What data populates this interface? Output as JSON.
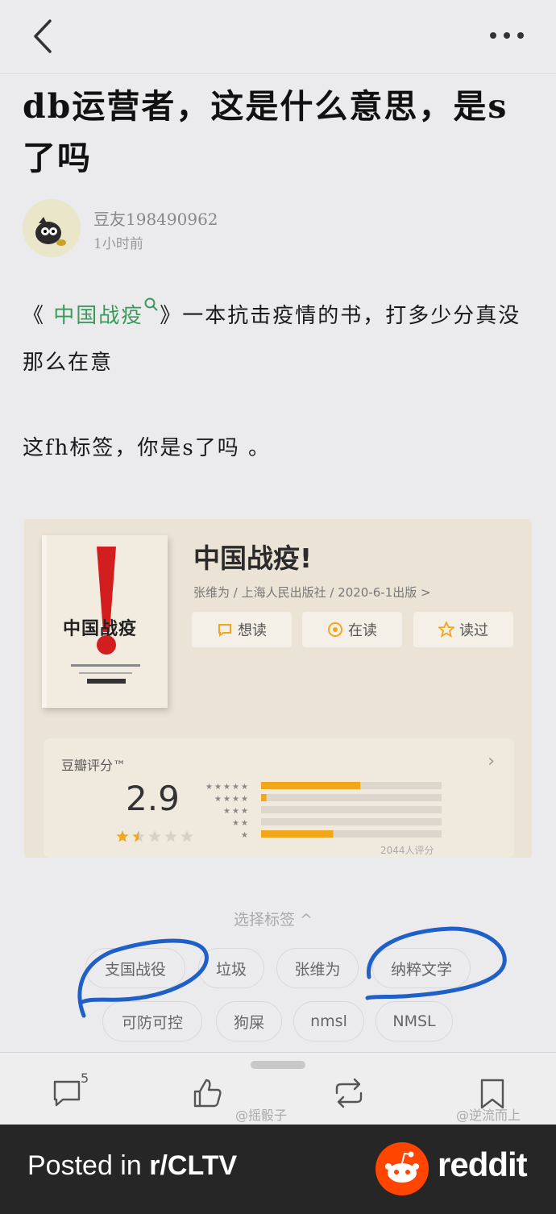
{
  "post": {
    "title": "db运营者，这是什么意思，是s了吗",
    "author": "豆友198490962",
    "time": "1小时前",
    "para1_open": "《",
    "para1_link": "中国战疫",
    "para1_rest": "》一本抗击疫情的书，打多少分真没那么在意",
    "para2": "这fh标签，你是s了吗 。"
  },
  "embedded": {
    "cover_title": "中国战疫",
    "book_title": "中国战疫!",
    "book_meta": "张维为 / 上海人民出版社 / 2020-6-1出版 >",
    "actions": [
      "想读",
      "在读",
      "读过"
    ],
    "rating_label": "豆瓣评分™",
    "rating_value": "2.9",
    "rating_count": "2044人评分",
    "star_distribution_pct": [
      55,
      3,
      0,
      0,
      40
    ],
    "tag_header": "选择标签 ^",
    "tags": [
      "支国战役",
      "垃圾",
      "张维为",
      "纳粹文学",
      "可防可控",
      "狗屎",
      "nmsl",
      "NMSL"
    ]
  },
  "toolbar": {
    "comment_count": "5",
    "icons": [
      "comment-icon",
      "like-icon",
      "repost-icon",
      "bookmark-icon"
    ],
    "watermark_left": "@摇骰子",
    "watermark_right": "@逆流而上"
  },
  "footer": {
    "posted_prefix": "Posted in ",
    "subreddit": "r/CLTV",
    "brand": "reddit"
  },
  "colors": {
    "link_green": "#3a9a5c",
    "bar_orange": "#f2a71b",
    "circle_blue": "#1f5fc8",
    "reddit_orange": "#ff4500"
  }
}
